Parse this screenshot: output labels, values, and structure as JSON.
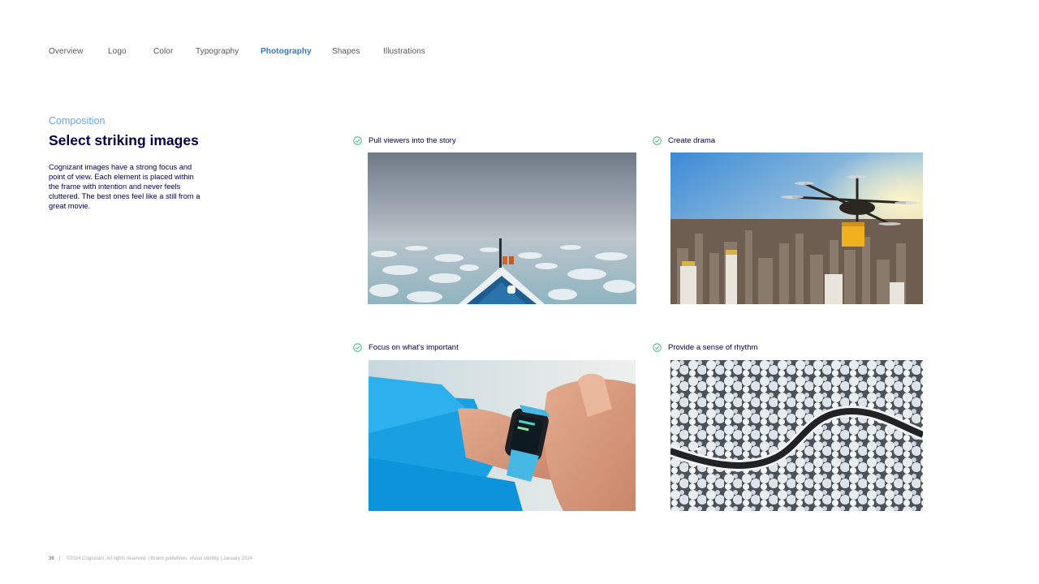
{
  "nav": {
    "items": [
      {
        "label": "Overview",
        "active": false
      },
      {
        "label": "Logo",
        "active": false
      },
      {
        "label": "Color",
        "active": false
      },
      {
        "label": "Typography",
        "active": false
      },
      {
        "label": "Photography",
        "active": true
      },
      {
        "label": "Shapes",
        "active": false
      },
      {
        "label": "Illustrations",
        "active": false
      }
    ]
  },
  "section": {
    "eyebrow": "Composition",
    "title": "Select striking images",
    "body": "Cognizant images have a strong focus and point of view. Each element is placed within the frame with intention and never feels cluttered. The best ones feel like a still from a great movie."
  },
  "cards": [
    {
      "label": "Pull viewers into the story",
      "icon": "check-circle-icon",
      "image": "ship bow breaking through sea ice"
    },
    {
      "label": "Create drama",
      "icon": "check-circle-icon",
      "image": "delivery drone over city skyline at sunset"
    },
    {
      "label": "Focus on what’s important",
      "icon": "check-circle-icon",
      "image": "hand tapping a smartwatch"
    },
    {
      "label": "Provide a sense of rhythm",
      "icon": "check-circle-icon",
      "image": "winding road through snowy forest"
    }
  ],
  "footer": {
    "page_number": "36",
    "text": "©2024 Cognizant. All rights reserved.  |  Brand guidelines: visual identity  |  January 2024"
  },
  "colors": {
    "navy": "#000048",
    "accent_blue": "#2f78c4",
    "light_blue": "#6aa6e4",
    "check_green": "#3bb273"
  }
}
